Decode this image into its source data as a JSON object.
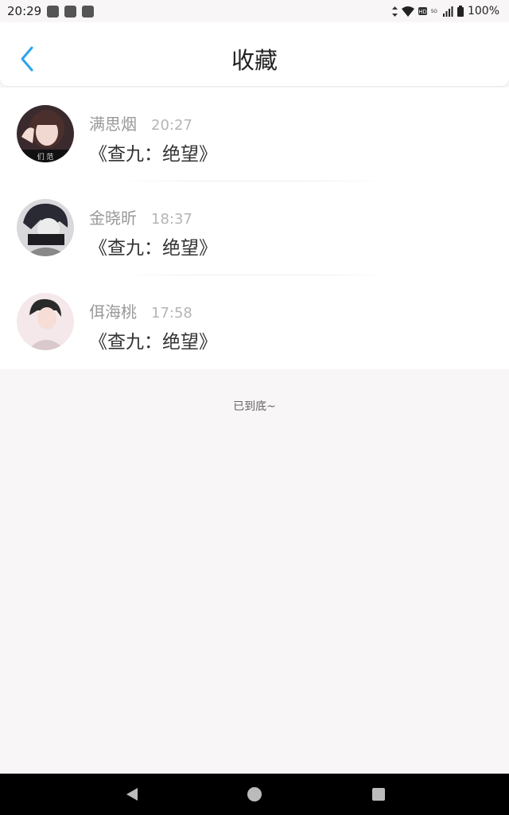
{
  "status_bar": {
    "time": "20:29",
    "battery": "100%",
    "network": "5G"
  },
  "header": {
    "title": "收藏"
  },
  "favorites": [
    {
      "name": "满思烟",
      "time": "20:27",
      "title": "《查九：绝望》"
    },
    {
      "name": "金晓昕",
      "time": "18:37",
      "title": "《查九：绝望》"
    },
    {
      "name": "佴海桃",
      "time": "17:58",
      "title": "《查九：绝望》"
    }
  ],
  "footer": {
    "end_text": "已到底~"
  },
  "colors": {
    "accent": "#2aa3ef",
    "background": "#f8f6f7",
    "name_gray": "#999999",
    "time_gray": "#b5b5b5"
  }
}
